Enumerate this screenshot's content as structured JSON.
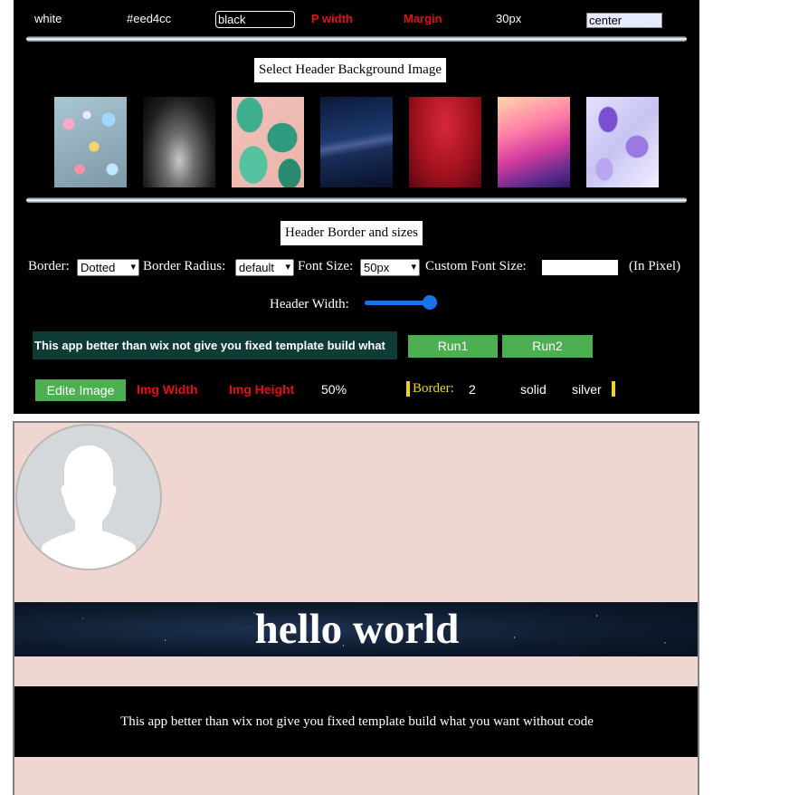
{
  "controls": {
    "text_color": "white",
    "bg_color": "#eed4cc",
    "header_bg_input": "black",
    "p_width_label": "P width",
    "margin_label": "Margin",
    "margin_value": "30px",
    "align_input": "center"
  },
  "bg_image_section": {
    "label": "Select Header Background Image",
    "images": [
      "bokeh-lights",
      "dark-smoke",
      "tropical-leaves",
      "milky-way",
      "red-rain",
      "pink-purple-gradient",
      "blue-purple-petals"
    ]
  },
  "border_section": {
    "label": "Header Border and sizes",
    "border_label": "Border:",
    "border_value": "Dotted",
    "radius_label": "Border Radius:",
    "radius_value": "default",
    "font_size_label": "Font Size:",
    "font_size_value": "50px",
    "custom_font_label": "Custom Font Size:",
    "custom_font_value": "",
    "pixel_note": "(In Pixel)",
    "width_label": "Header Width:",
    "width_level": 0.85
  },
  "paragraph_input": "This app better than wix not give you fixed template build what",
  "buttons": {
    "run1": "Run1",
    "run2": "Run2",
    "edit_image": "Edite Image"
  },
  "image_controls": {
    "img_width_label": "Img Width",
    "img_height_label": "Img Height",
    "img_size_value": "50%",
    "border_label": "Border:",
    "border_width": "2",
    "border_style": "solid",
    "border_color": "silver"
  },
  "preview": {
    "title": "hello world",
    "paragraph": "This app better than wix not give you fixed template build what you want without code"
  },
  "colors": {
    "accent_green": "#4caf50",
    "label_red": "#e41010",
    "preview_bg": "#eed4cc",
    "border_yellow": "#f3d21c"
  }
}
